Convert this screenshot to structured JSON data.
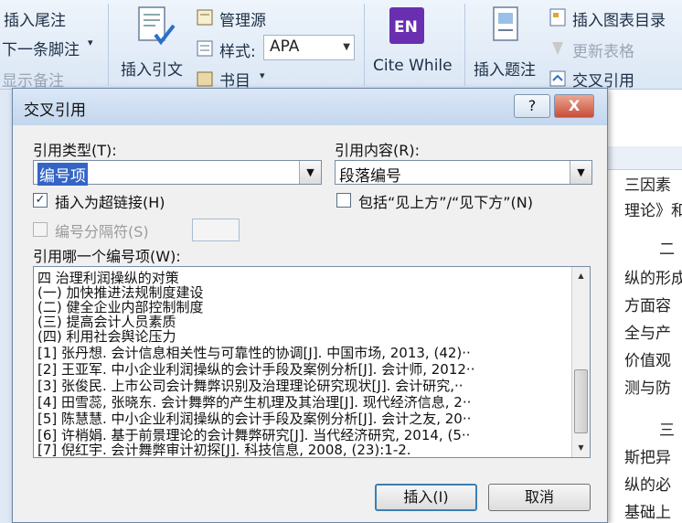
{
  "ribbon": {
    "insert_footnote": "插入尾注",
    "next_footnote": "下一条脚注",
    "show_notes": "显示备注",
    "insert_citation": "插入引文",
    "manage_sources": "管理源",
    "style_label": "样式:",
    "style_value": "APA",
    "bibliography": "书目",
    "endnote_logo": "EN",
    "cite_while": "Cite While",
    "insert_caption": "插入题注",
    "insert_table_of_figures": "插入图表目录",
    "update_table": "更新表格",
    "cross_reference": "交叉引用"
  },
  "dialog": {
    "title": "交叉引用",
    "help_button": "?",
    "close_button": "X",
    "reference_type_label": "引用类型(T):",
    "reference_type_value": "编号项",
    "insert_reference_to_label": "引用内容(R):",
    "insert_reference_to_value": "段落编号",
    "insert_as_hyperlink_label": "插入为超链接(H)",
    "include_above_below_label": "包括“见上方”/“见下方”(N)",
    "separate_numbers_label": "编号分隔符(S)",
    "for_which_item_label": "引用哪一个编号项(W):",
    "items": [
      "四 治理利润操纵的对策",
      "(一) 加快推进法规制度建设",
      "(二) 健全企业内部控制制度",
      "(三) 提高会计人员素质",
      "(四) 利用社会舆论压力",
      "[1] 张丹想. 会计信息相关性与可靠性的协调[J]. 中国市场, 2013, (42)··",
      "[2] 王亚军. 中小企业利润操纵的会计手段及案例分析[J]. 会计师, 2012··",
      "[3] 张俊民. 上市公司会计舞弊识别及治理理论研究现状[J]. 会计研究,··",
      "[4] 田雪蕊, 张晓东. 会计舞弊的产生机理及其治理[J]. 现代经济信息, 2··",
      "[5] 陈慧慧. 中小企业利润操纵的会计手段及案例分析[J]. 会计之友, 20··",
      "[6] 许梢娟. 基于前景理论的会计舞弊研究[J]. 当代经济研究, 2014, (5··",
      "[7] 倪红宇. 会计舞弊审计初探[J]. 科技信息, 2008, (23):1-2."
    ],
    "insert_button": "插入(I)",
    "cancel_button": "取消"
  },
  "document": {
    "lines": [
      "三因素",
      "理论》和",
      "二",
      "纵的形成",
      "方面容",
      "全与产",
      "价值观",
      "测与防",
      "三",
      "斯把异",
      "纵的必",
      "基础上"
    ]
  }
}
